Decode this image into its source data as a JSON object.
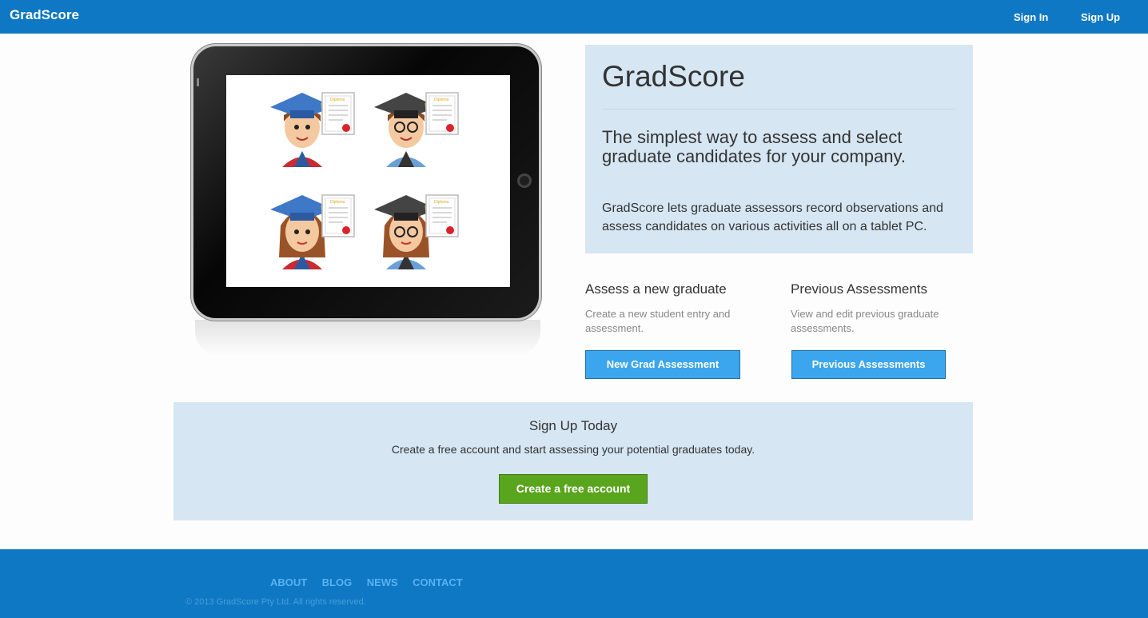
{
  "nav": {
    "brand": "GradScore",
    "sign_in": "Sign In",
    "sign_up": "Sign Up"
  },
  "hero": {
    "title": "GradScore",
    "tagline": "The simplest way to assess and select graduate candidates for your company.",
    "description": "GradScore lets graduate assessors record observations and assess candidates on various activities all on a tablet PC."
  },
  "actions": [
    {
      "heading": "Assess a new graduate",
      "text": "Create a new student entry and assessment.",
      "button": "New Grad Assessment"
    },
    {
      "heading": "Previous Assessments",
      "text": "View and edit previous graduate assessments.",
      "button": "Previous Assessments"
    }
  ],
  "signup": {
    "heading": "Sign Up Today",
    "text": "Create a free account and start assessing your potential graduates today.",
    "button": "Create a free account"
  },
  "illustration": {
    "diploma_label": "Diploma"
  },
  "footer": {
    "links": [
      "ABOUT",
      "BLOG",
      "NEWS",
      "CONTACT"
    ],
    "copyright": "© 2013 GradScore Pty Ltd. All rights reserved."
  },
  "colors": {
    "brand_blue": "#0e78c4",
    "panel": "#d6e6f3",
    "button_blue": "#3ba6ee",
    "button_green": "#5aa51e"
  }
}
